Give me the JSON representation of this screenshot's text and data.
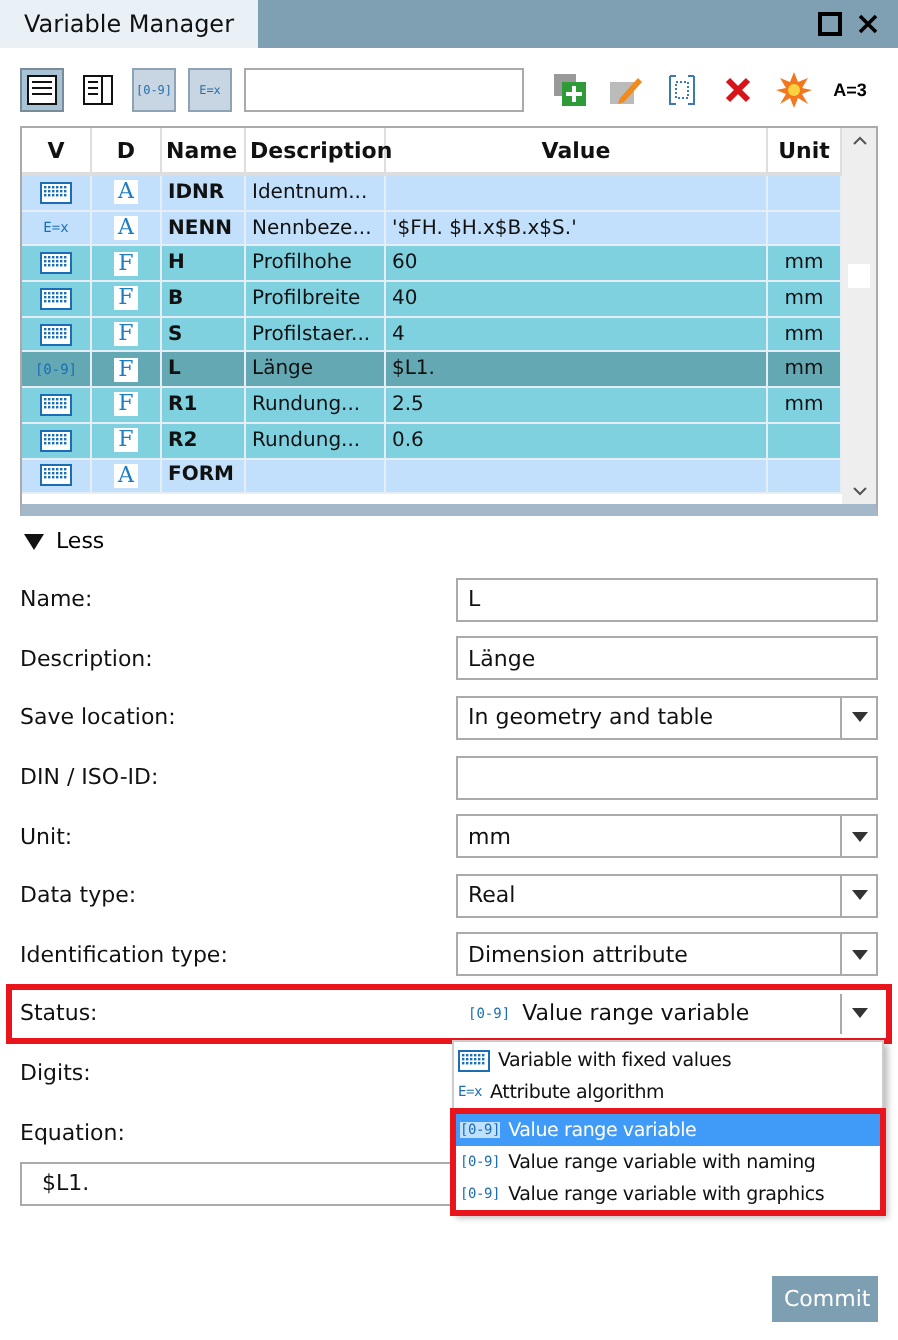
{
  "window": {
    "title": "Variable Manager"
  },
  "toolbar": {
    "views": [
      {
        "kind": "rows",
        "selected": true
      },
      {
        "kind": "details",
        "selected": false
      },
      {
        "kind": "range",
        "text": "[0-9]",
        "selected": false
      },
      {
        "kind": "algorithm",
        "text": "E=x",
        "selected": false
      }
    ],
    "actions": [
      {
        "kind": "add"
      },
      {
        "kind": "edit"
      },
      {
        "kind": "select"
      },
      {
        "kind": "delete"
      },
      {
        "kind": "burst"
      },
      {
        "kind": "text",
        "text": "A=3"
      }
    ]
  },
  "table": {
    "columns": [
      "V",
      "D",
      "Name",
      "Description",
      "Value",
      "Unit"
    ],
    "rows": [
      {
        "v": {
          "kind": "fixed"
        },
        "d": "A",
        "name": "IDNR",
        "description": "Identnum...",
        "value": "",
        "unit": "",
        "highlighted": false,
        "selected": false
      },
      {
        "v": {
          "kind": "algorithm",
          "text": "E=x"
        },
        "d": "A",
        "name": "NENN",
        "description": "Nennbeze...",
        "value": "'$FH. $H.x$B.x$S.'",
        "unit": "",
        "highlighted": false,
        "selected": false
      },
      {
        "v": {
          "kind": "fixed"
        },
        "d": "F",
        "name": "H",
        "description": "Profilhohe",
        "value": "60",
        "unit": "mm",
        "highlighted": true,
        "selected": false
      },
      {
        "v": {
          "kind": "fixed"
        },
        "d": "F",
        "name": "B",
        "description": "Profilbreite",
        "value": "40",
        "unit": "mm",
        "highlighted": true,
        "selected": false
      },
      {
        "v": {
          "kind": "fixed"
        },
        "d": "F",
        "name": "S",
        "description": "Profilstaer...",
        "value": "4",
        "unit": "mm",
        "highlighted": true,
        "selected": false
      },
      {
        "v": {
          "kind": "range",
          "text": "[0-9]"
        },
        "d": "F",
        "name": "L",
        "description": "Länge",
        "value": "$L1.",
        "unit": "mm",
        "highlighted": true,
        "selected": true
      },
      {
        "v": {
          "kind": "fixed"
        },
        "d": "F",
        "name": "R1",
        "description": "Rundung...",
        "value": "2.5",
        "unit": "mm",
        "highlighted": true,
        "selected": false
      },
      {
        "v": {
          "kind": "fixed"
        },
        "d": "F",
        "name": "R2",
        "description": "Rundung...",
        "value": "0.6",
        "unit": "",
        "highlighted": true,
        "selected": false
      },
      {
        "v": {
          "kind": "fixed"
        },
        "d": "A",
        "name": "FORM",
        "description": "",
        "value": "",
        "unit": "",
        "highlighted": false,
        "selected": false
      }
    ]
  },
  "toggle": {
    "label": "Less",
    "expanded": true
  },
  "form": [
    {
      "kind": "text",
      "label": "Name:",
      "value": "L"
    },
    {
      "kind": "text",
      "label": "Description:",
      "value": "Länge"
    },
    {
      "kind": "select",
      "label": "Save location:",
      "value": "In geometry and table"
    },
    {
      "kind": "text",
      "label": "DIN / ISO-ID:"
    },
    {
      "kind": "select",
      "label": "Unit:",
      "value": "mm"
    },
    {
      "kind": "select",
      "label": "Data type:",
      "value": "Real"
    },
    {
      "kind": "select",
      "label": "Identification type:",
      "value": "Dimension attribute"
    },
    {
      "kind": "status",
      "label": "Status:",
      "value": "Value range variable",
      "icon": {
        "kind": "range",
        "text": "[0-9]"
      },
      "highlighted": true
    },
    {
      "kind": "covered",
      "label": "Digits:"
    },
    {
      "kind": "wide",
      "label": "Equation:",
      "value": "$L1."
    }
  ],
  "dropdown": {
    "items": [
      {
        "icon": {
          "kind": "fixed"
        },
        "label": "Variable with fixed values",
        "selected": false,
        "framed": false
      },
      {
        "icon": {
          "kind": "algorithm",
          "text": "E=x"
        },
        "label": "Attribute algorithm",
        "selected": false,
        "framed": false
      },
      {
        "icon": {
          "kind": "range",
          "text": "[0-9]"
        },
        "label": "Value range variable",
        "selected": true,
        "framed": true
      },
      {
        "icon": {
          "kind": "range",
          "text": "[0-9]"
        },
        "label": "Value range variable with naming",
        "selected": false,
        "framed": true
      },
      {
        "icon": {
          "kind": "range",
          "text": "[0-9]"
        },
        "label": "Value range variable with graphics",
        "selected": false,
        "framed": true
      }
    ]
  },
  "commit": {
    "label": "Commit",
    "disabled": true
  }
}
